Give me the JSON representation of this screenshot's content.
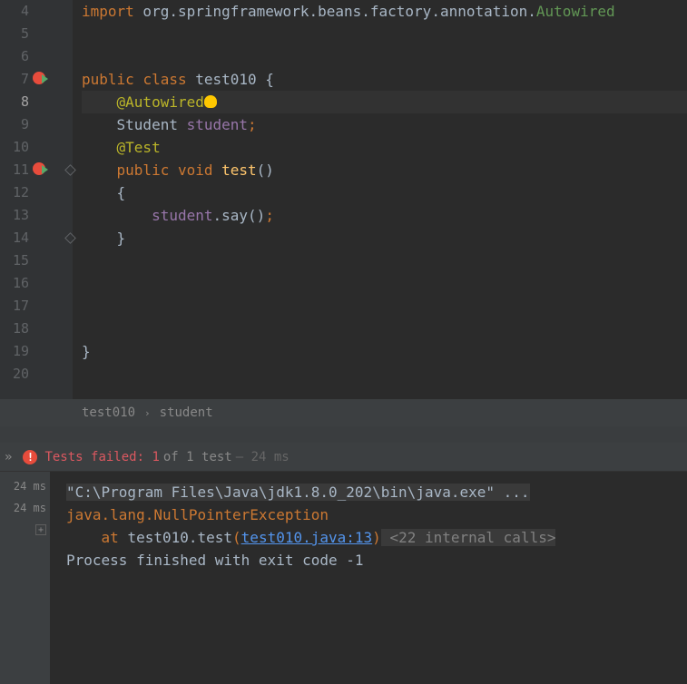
{
  "lines": {
    "l4": {
      "num": "4"
    },
    "l5": {
      "num": "5"
    },
    "l6": {
      "num": "6"
    },
    "l7": {
      "num": "7"
    },
    "l8": {
      "num": "8"
    },
    "l9": {
      "num": "9"
    },
    "l10": {
      "num": "10"
    },
    "l11": {
      "num": "11"
    },
    "l12": {
      "num": "12"
    },
    "l13": {
      "num": "13"
    },
    "l14": {
      "num": "14"
    },
    "l15": {
      "num": "15"
    },
    "l16": {
      "num": "16"
    },
    "l17": {
      "num": "17"
    },
    "l18": {
      "num": "18"
    },
    "l19": {
      "num": "19"
    },
    "l20": {
      "num": "20"
    }
  },
  "code": {
    "line4_import": "import",
    "line4_pkg": " org.springframework.beans.factory.annotation.",
    "line4_class": "Autowired",
    "line7_public": "public ",
    "line7_class": "class ",
    "line7_name": "test010 ",
    "line7_brace": "{",
    "line8_anno": "    @Autowired",
    "line9_type": "    Student ",
    "line9_var": "student",
    "line9_semi": ";",
    "line10_test": "    @Test",
    "line11_public": "    public ",
    "line11_void": "void ",
    "line11_method": "test",
    "line11_parens": "()",
    "line12_brace": "    {",
    "line13_var": "        student",
    "line13_dot": ".",
    "line13_method": "say",
    "line13_parens": "()",
    "line13_semi": ";",
    "line14_brace": "    }",
    "line19_brace": "}"
  },
  "breadcrumb": {
    "item1": "test010",
    "item2": "student",
    "sep": "›"
  },
  "testResults": {
    "chevron": "»",
    "failed_label": "Tests failed: 1",
    "count_label": " of 1 test",
    "time_label": " – 24 ms"
  },
  "testTree": {
    "time1": "24 ms",
    "time2": "24 ms",
    "expand": "+"
  },
  "console": {
    "cmd": "\"C:\\Program Files\\Java\\jdk1.8.0_202\\bin\\java.exe\" ...",
    "exception": "java.lang.NullPointerException",
    "at": "    at ",
    "method": "test010.test",
    "paren_open": "(",
    "link": "test010.java:13",
    "paren_close": ")",
    "internal": " <22 internal calls>",
    "exit": "Process finished with exit code -1"
  }
}
